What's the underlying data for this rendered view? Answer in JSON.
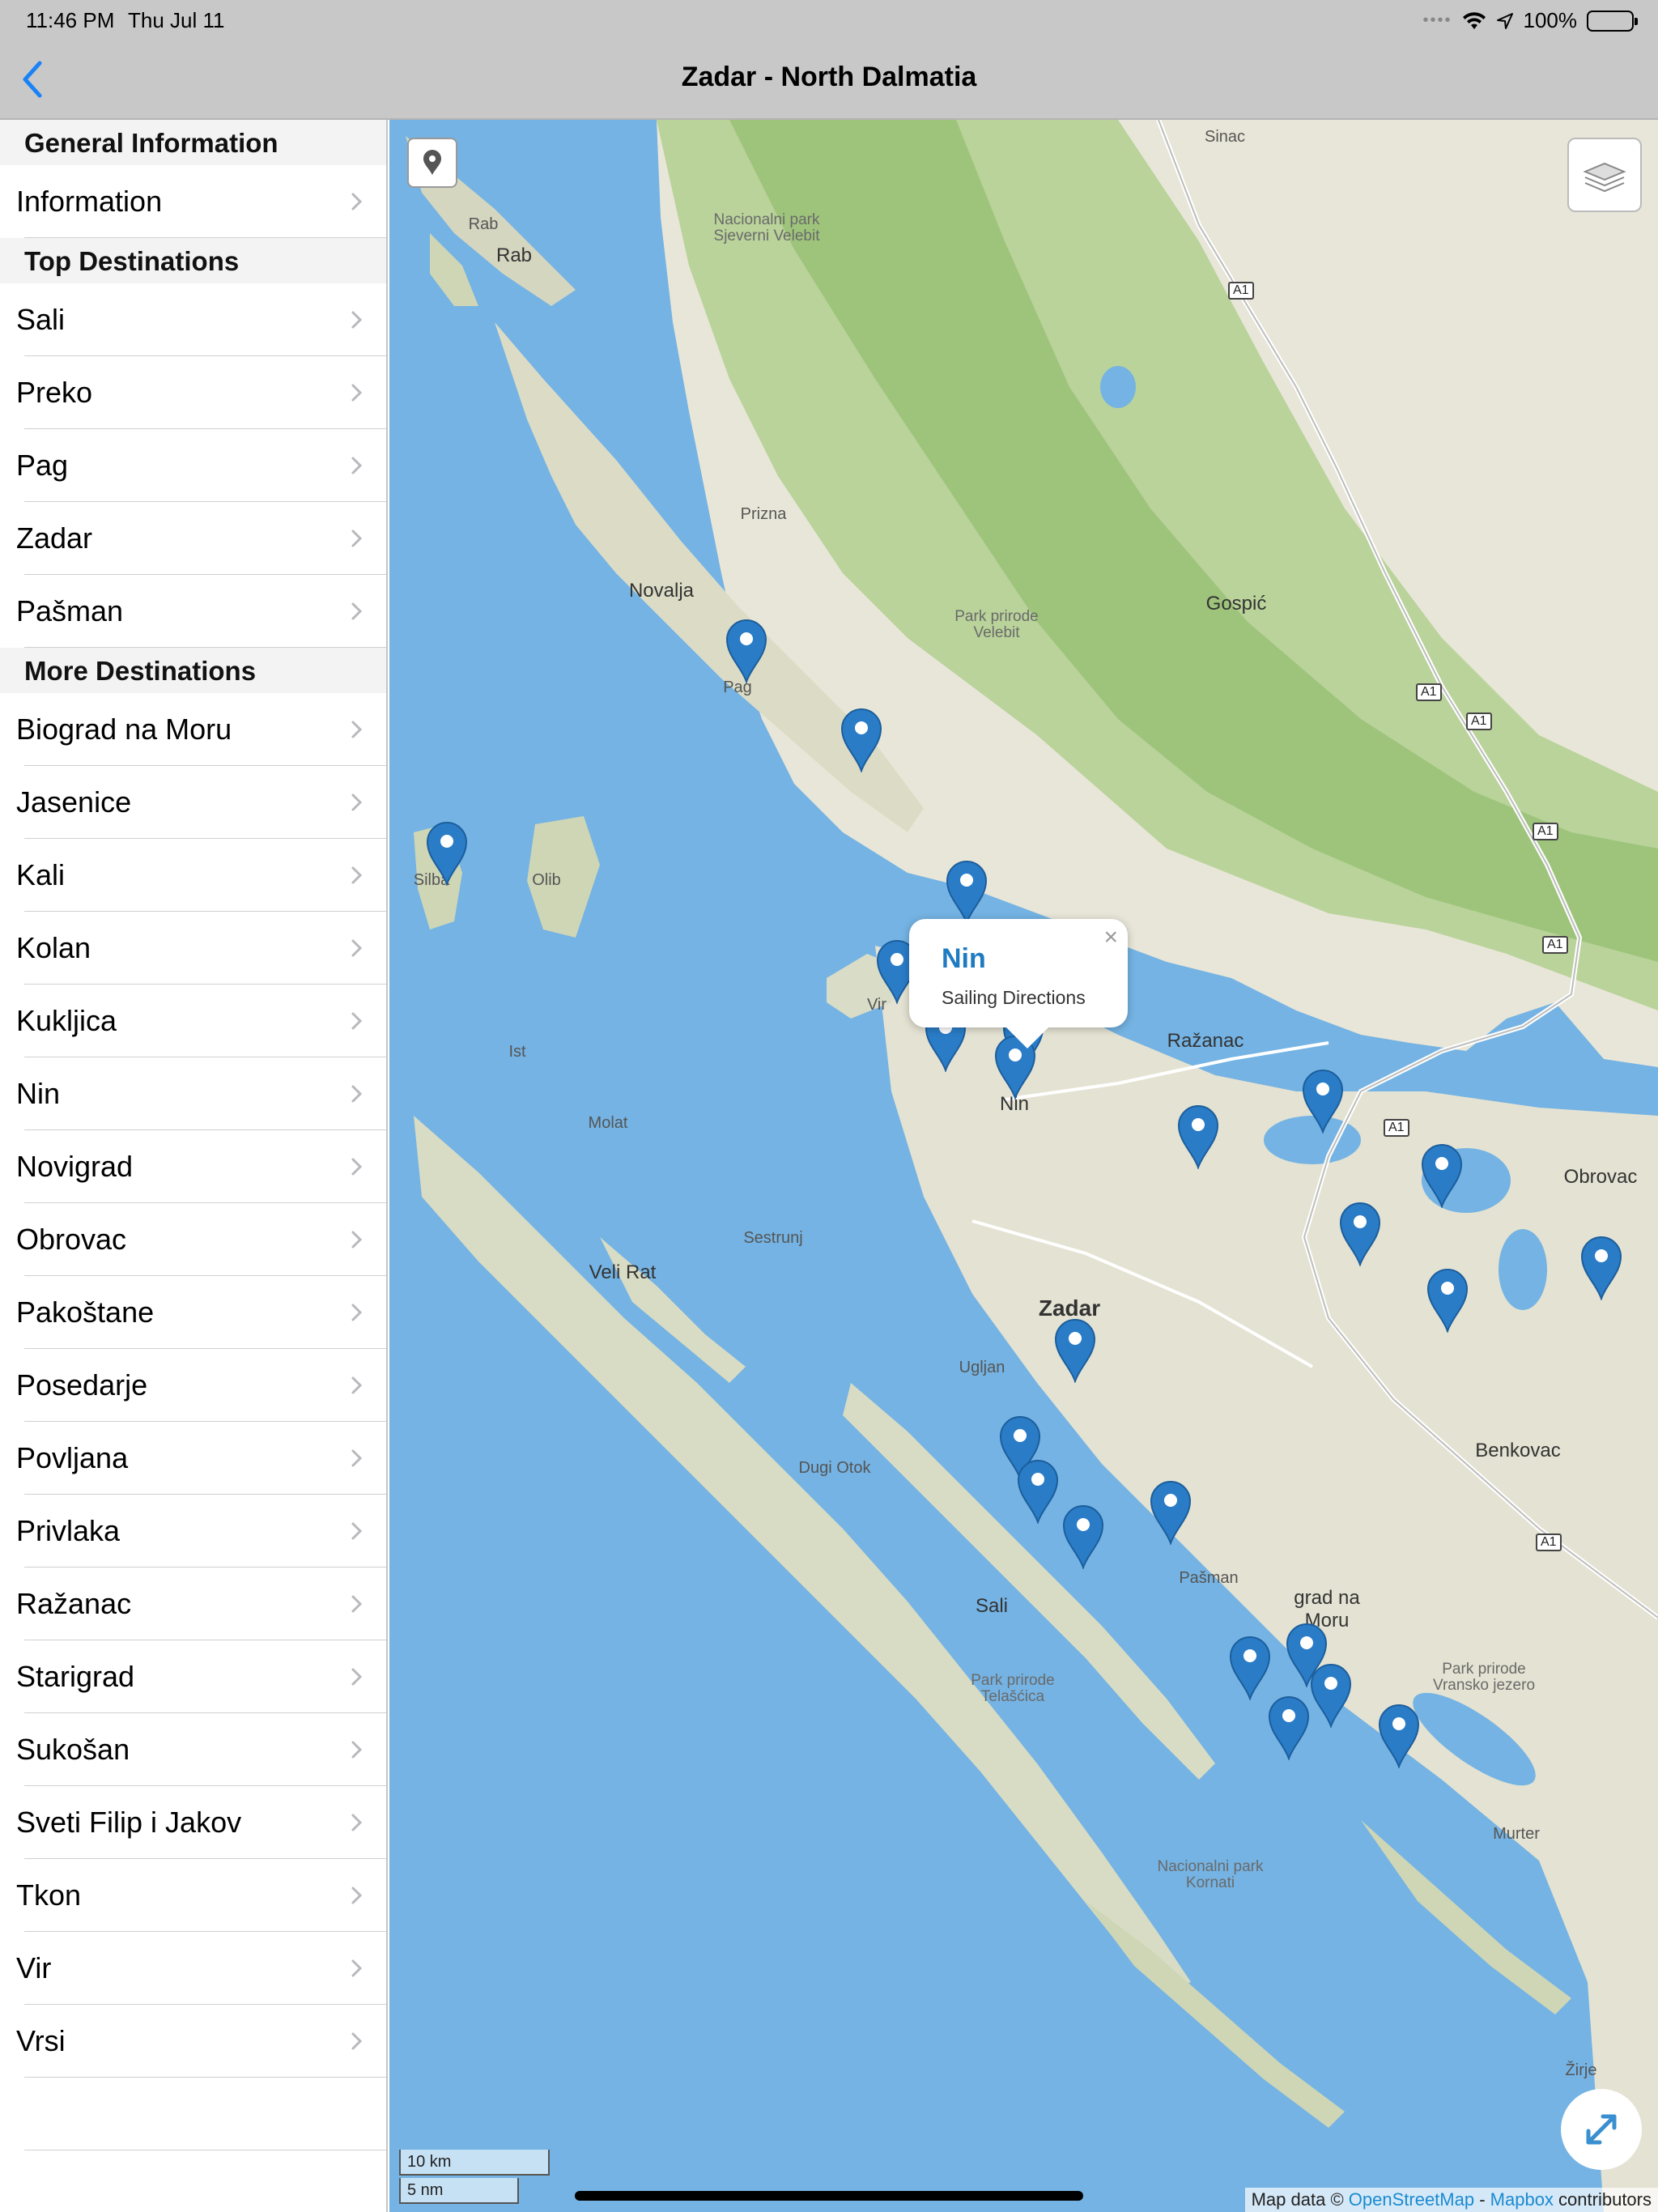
{
  "status": {
    "time": "11:46 PM",
    "date": "Thu Jul 11",
    "battery": "100%"
  },
  "nav": {
    "title": "Zadar - North Dalmatia"
  },
  "sidebar": {
    "sections": [
      {
        "header": "General Information",
        "items": [
          "Information"
        ]
      },
      {
        "header": "Top Destinations",
        "items": [
          "Sali",
          "Preko",
          "Pag",
          "Zadar",
          "Pašman"
        ]
      },
      {
        "header": "More Destinations",
        "items": [
          "Biograd na Moru",
          "Jasenice",
          "Kali",
          "Kolan",
          "Kukljica",
          "Nin",
          "Novigrad",
          "Obrovac",
          "Pakoštane",
          "Posedarje",
          "Povljana",
          "Privlaka",
          "Ražanac",
          "Starigrad",
          "Sukošan",
          "Sveti Filip i Jakov",
          "Tkon",
          "Vir",
          "Vrsi"
        ]
      }
    ]
  },
  "map": {
    "labels": {
      "sinac": "Sinac",
      "rab1": "Rab",
      "rab2": "Rab",
      "park1": "Nacionalni park\nSjeverni Velebit",
      "prizna": "Prizna",
      "novalja": "Novalja",
      "gospic": "Gospić",
      "park2": "Park prirode\nVelebit",
      "pag": "Pag",
      "silba": "Silba",
      "olib": "Olib",
      "vir": "Vir",
      "razanac": "Ražanac",
      "nin": "Nin",
      "ist": "Ist",
      "molat": "Molat",
      "obrovac": "Obrovac",
      "sestrunj": "Sestrunj",
      "veli_rat": "Veli Rat",
      "zadar": "Zadar",
      "ugljan": "Ugljan",
      "benkovac": "Benkovac",
      "dugi_otok": "Dugi Otok",
      "sali": "Sali",
      "pasman": "Pašman",
      "biograd": "grad na\nMoru",
      "park3": "Park prirode\nTelašćica",
      "park4": "Park prirode\nVransko jezero",
      "murter": "Murter",
      "park5": "Nacionalni park\nKornati",
      "zirje": "Žirje"
    },
    "shields": [
      "A1",
      "A1",
      "A1",
      "A1",
      "A1",
      "A1",
      "A1"
    ],
    "popup": {
      "title": "Nin",
      "subtitle": "Sailing Directions",
      "close": "×"
    },
    "scale": {
      "km": "10 km",
      "nm": "5 nm"
    },
    "attribution": {
      "prefix": "Map data © ",
      "osm": "OpenStreetMap",
      "sep": " - ",
      "mapbox": "Mapbox",
      "suffix": " contributors"
    }
  }
}
